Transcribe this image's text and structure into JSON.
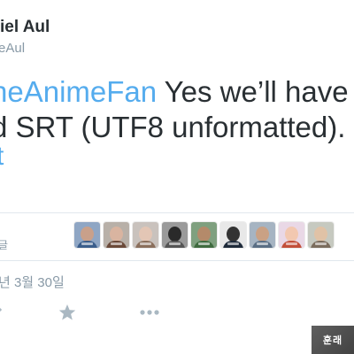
{
  "author": {
    "name": "iel Aul",
    "handle": "eAul"
  },
  "tweet": {
    "mention": "heAnimeFan",
    "line1_rest": " Yes we’ll have",
    "line2": "d SRT (UTF8 unformatted).",
    "link_fragment": "t"
  },
  "engagement": {
    "likes_label": "글",
    "avatars": [
      {
        "face": "#c9a08a",
        "body": "#3b5e8c",
        "bg": "#8fa6c4"
      },
      {
        "face": "#d9b4a0",
        "body": "#6b4a3a",
        "bg": "#b8b0a8"
      },
      {
        "face": "#e3c6b5",
        "body": "#8a6f5c",
        "bg": "#c9c2bd"
      },
      {
        "face": "#2a2a2a",
        "body": "#555555",
        "bg": "#9a9a9a"
      },
      {
        "face": "#b48a6a",
        "body": "#3f6b3f",
        "bg": "#7fa07f"
      },
      {
        "face": "#333333",
        "body": "#1e2a3a",
        "bg": "#e8e8e8"
      },
      {
        "face": "#caa184",
        "body": "#5a6e84",
        "bg": "#a6b4c2"
      },
      {
        "face": "#f2c8b0",
        "body": "#c24f3a",
        "bg": "#e9d8e6"
      },
      {
        "face": "#e0c2a6",
        "body": "#7b6d5e",
        "bg": "#c6c9c0"
      }
    ]
  },
  "meta": {
    "timestamp": "년 3월 30일"
  },
  "actions": {
    "reply": "reply-icon",
    "favorite": "star-icon",
    "more": "more-icon"
  },
  "watermark": {
    "text": "훈래"
  }
}
